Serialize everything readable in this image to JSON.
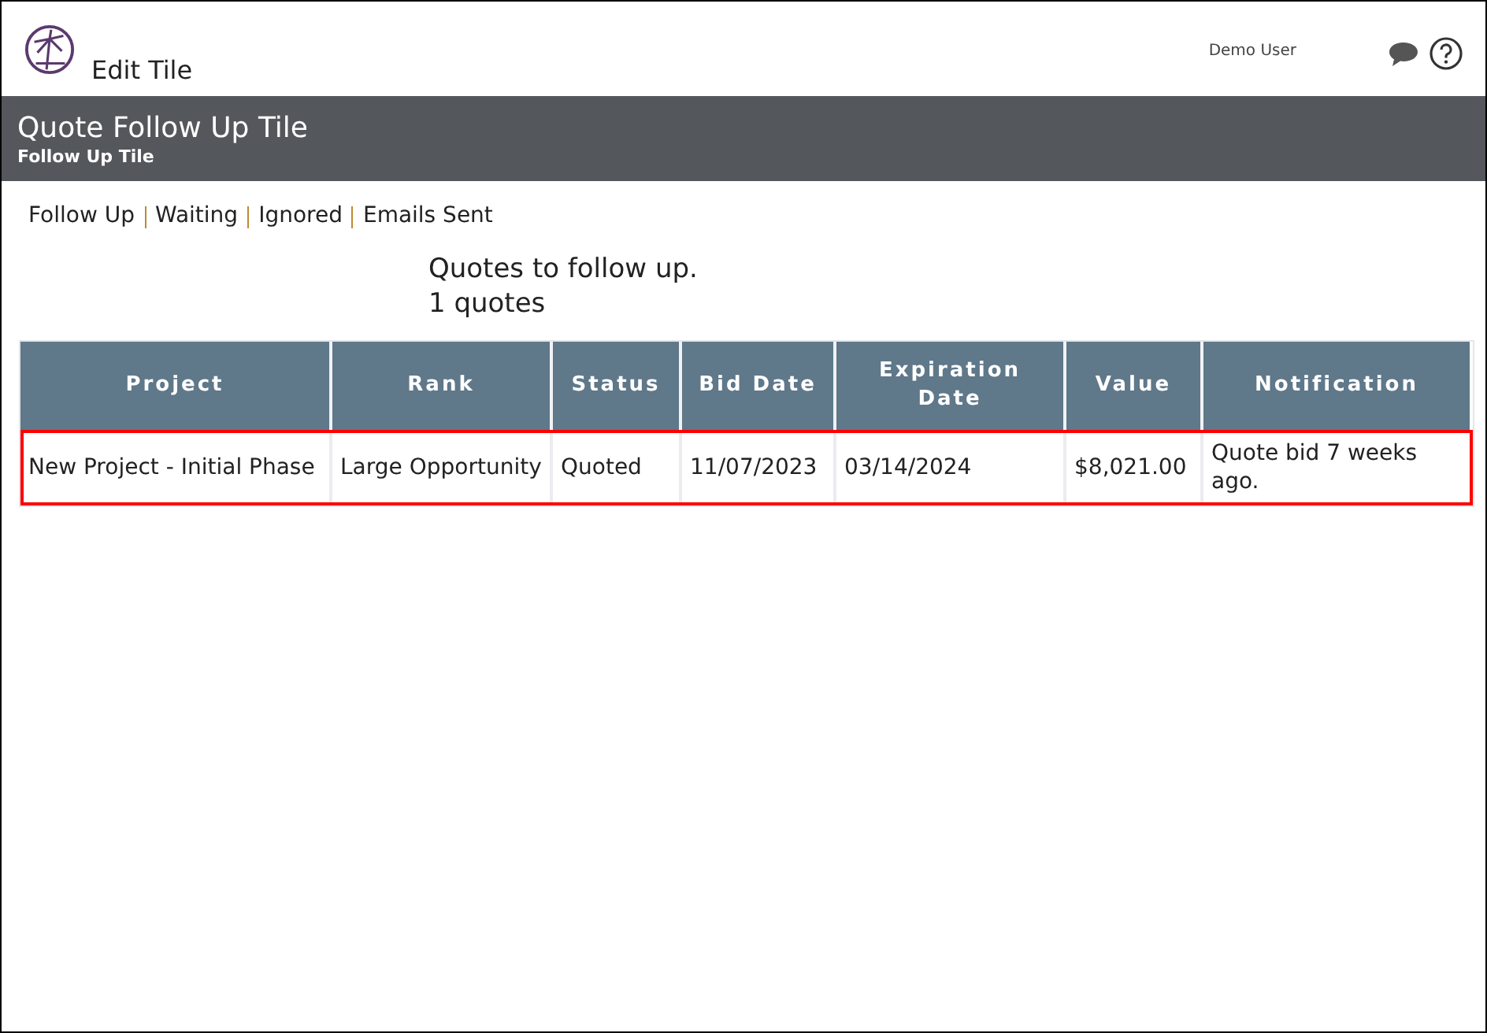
{
  "header": {
    "title": "Edit Tile",
    "user": "Demo User"
  },
  "banner": {
    "title": "Quote Follow Up Tile",
    "subtitle": "Follow Up Tile"
  },
  "nav_links": [
    "Follow Up",
    "Waiting",
    "Ignored",
    "Emails Sent"
  ],
  "summary": {
    "heading": "Quotes to follow up.",
    "count": "1 quotes"
  },
  "table": {
    "columns": [
      "Project",
      "Rank",
      "Status",
      "Bid Date",
      "Expiration Date",
      "Value",
      "Notification"
    ],
    "rows": [
      {
        "selected": true,
        "cells": [
          "New Project - Initial Phase",
          "Large Opportunity",
          "Quoted",
          "11/07/2023",
          "03/14/2024",
          "$8,021.00",
          "Quote bid 7 weeks ago."
        ]
      }
    ]
  }
}
